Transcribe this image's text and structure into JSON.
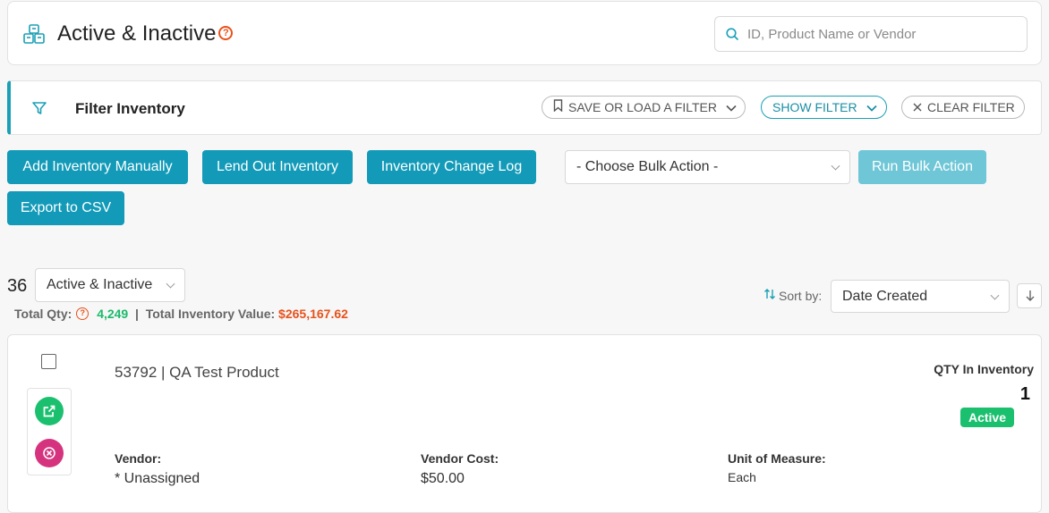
{
  "header": {
    "title": "Active & Inactive",
    "help_glyph": "?",
    "search_placeholder": "ID, Product Name or Vendor"
  },
  "filter": {
    "title": "Filter Inventory",
    "save_load_label": "SAVE OR LOAD A FILTER",
    "show_filter_label": "SHOW FILTER",
    "clear_filter_label": "CLEAR FILTER"
  },
  "actions": {
    "add_manually": "Add Inventory Manually",
    "lend_out": "Lend Out Inventory",
    "change_log": "Inventory Change Log",
    "bulk_action_select": "- Choose Bulk Action -",
    "run_bulk_action": "Run Bulk Action",
    "export_csv": "Export to CSV"
  },
  "summary": {
    "count": "36",
    "status_filter": "Active & Inactive",
    "total_qty_label": "Total Qty:",
    "total_qty_value": "4,249",
    "separator": "|",
    "total_value_label": "Total Inventory Value:",
    "total_value_value": "$265,167.62",
    "sort_label": "Sort by:",
    "sort_value": "Date Created"
  },
  "item": {
    "name": "53792 | QA Test Product",
    "qty_label": "QTY In Inventory",
    "qty_value": "1",
    "status": "Active",
    "vendor_label": "Vendor:",
    "vendor_value": "* Unassigned",
    "cost_label": "Vendor Cost:",
    "cost_value": "$50.00",
    "unit_label": "Unit of Measure:",
    "unit_value": "Each"
  },
  "colors": {
    "accent": "#129ab8",
    "accent_disabled": "#6ec6d7",
    "success": "#1bc06f",
    "danger": "#d6337e",
    "warning": "#e8521b"
  },
  "icons": {
    "header": "inventory-boxes-icon",
    "help": "help-circle-icon",
    "search": "search-icon",
    "filter": "filter-funnel-icon",
    "bookmark": "bookmark-icon",
    "chevron": "chevron-down-icon",
    "close": "close-icon",
    "sort": "sort-arrows-icon",
    "sort_direction": "arrow-down-icon",
    "open": "external-link-icon",
    "delete": "delete-circle-icon"
  }
}
